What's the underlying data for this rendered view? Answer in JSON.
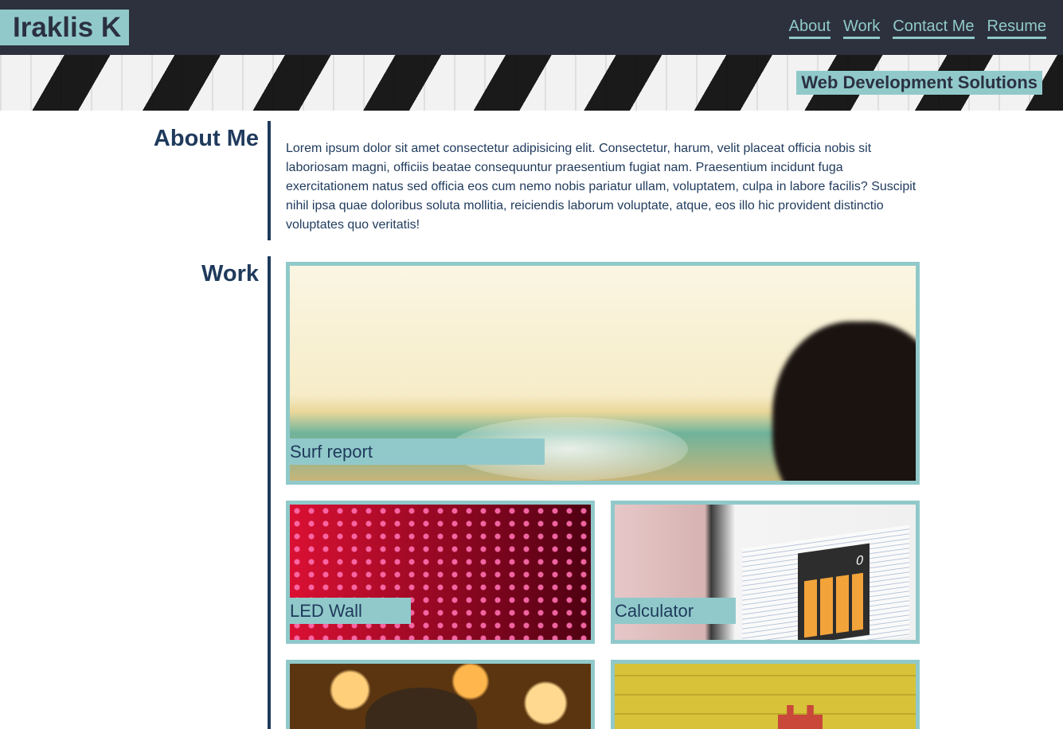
{
  "header": {
    "brand": "Iraklis K",
    "nav": [
      "About",
      "Work",
      "Contact Me",
      "Resume"
    ],
    "tagline": "Web Development Solutions"
  },
  "about": {
    "title": "About Me",
    "text": "Lorem ipsum dolor sit amet consectetur adipisicing elit. Consectetur, harum, velit placeat officia nobis sit laboriosam magni, officiis beatae consequuntur praesentium fugiat nam. Praesentium incidunt fuga exercitationem natus sed officia eos cum nemo nobis pariatur ullam, voluptatem, culpa in labore facilis? Suscipit nihil ipsa quae doloribus soluta mollitia, reiciendis laborum voluptate, atque, eos illo hic provident distinctio voluptates quo veritatis!"
  },
  "work": {
    "title": "Work",
    "projects": [
      {
        "label": "Surf report"
      },
      {
        "label": "LED Wall"
      },
      {
        "label": "Calculator",
        "screen_value": "0"
      },
      {
        "label": ""
      },
      {
        "label": ""
      }
    ]
  },
  "colors": {
    "header_bg": "#2c313d",
    "accent": "#91c9ca",
    "text": "#1f3a5c"
  }
}
